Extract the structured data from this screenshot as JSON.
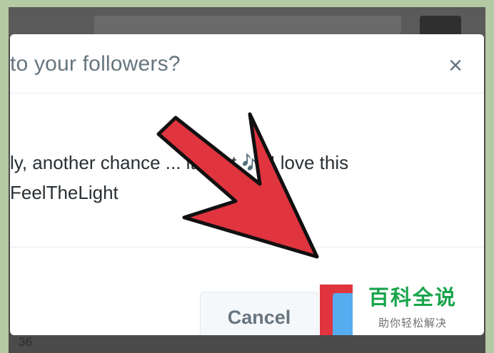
{
  "background": {
    "retweet_count": "36"
  },
  "dialog": {
    "title": "to your followers?",
    "close_label": "×",
    "tweet_line1": "ly, another chance ... it right 🎶 I love this",
    "tweet_line2": "FeelTheLight",
    "cancel_label": "Cancel",
    "retweet_label": ""
  },
  "watermark": {
    "main": "百科全说",
    "sub": "助你轻松解决"
  },
  "colors": {
    "arrow": "#e0343f",
    "highlight": "#e0343f",
    "retweet_button": "#55acee",
    "watermark_text": "#19a44b"
  },
  "icons": [
    "close-icon",
    "pointer-arrow-icon",
    "music-notes-icon"
  ]
}
